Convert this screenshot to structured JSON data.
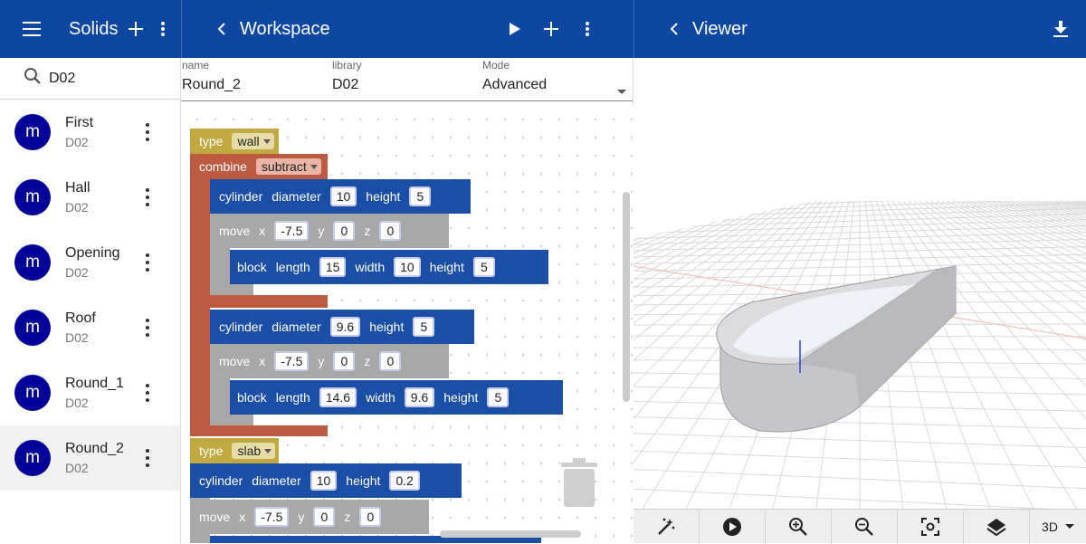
{
  "left_bar": {
    "title": "Solids"
  },
  "middle_bar": {
    "title": "Workspace"
  },
  "right_bar": {
    "title": "Viewer"
  },
  "search": {
    "value": "D02"
  },
  "solids": [
    {
      "initial": "m",
      "name": "First",
      "library": "D02"
    },
    {
      "initial": "m",
      "name": "Hall",
      "library": "D02"
    },
    {
      "initial": "m",
      "name": "Opening",
      "library": "D02"
    },
    {
      "initial": "m",
      "name": "Roof",
      "library": "D02"
    },
    {
      "initial": "m",
      "name": "Round_1",
      "library": "D02"
    },
    {
      "initial": "m",
      "name": "Round_2",
      "library": "D02",
      "selected": true
    }
  ],
  "fields": {
    "name_label": "name",
    "name_value": "Round_2",
    "library_label": "library",
    "library_value": "D02",
    "mode_label": "Mode",
    "mode_value": "Advanced"
  },
  "blocks": {
    "type1": {
      "label": "type",
      "value": "wall"
    },
    "combine": {
      "label": "combine",
      "value": "subtract"
    },
    "cyl1": {
      "label": "cylinder",
      "diameter_label": "diameter",
      "diameter": "10",
      "height_label": "height",
      "height": "5"
    },
    "move1": {
      "label": "move",
      "x_label": "x",
      "x": "-7.5",
      "y_label": "y",
      "y": "0",
      "z_label": "z",
      "z": "0"
    },
    "block1": {
      "label": "block",
      "length_label": "length",
      "length": "15",
      "width_label": "width",
      "width": "10",
      "height_label": "height",
      "height": "5"
    },
    "cyl2": {
      "label": "cylinder",
      "diameter_label": "diameter",
      "diameter": "9.6",
      "height_label": "height",
      "height": "5"
    },
    "move2": {
      "label": "move",
      "x_label": "x",
      "x": "-7.5",
      "y_label": "y",
      "y": "0",
      "z_label": "z",
      "z": "0"
    },
    "block2": {
      "label": "block",
      "length_label": "length",
      "length": "14.6",
      "width_label": "width",
      "width": "9.6",
      "height_label": "height",
      "height": "5"
    },
    "type2": {
      "label": "type",
      "value": "slab"
    },
    "cyl3": {
      "label": "cylinder",
      "diameter_label": "diameter",
      "diameter": "10",
      "height_label": "height",
      "height": "0.2"
    },
    "move3": {
      "label": "move",
      "x_label": "x",
      "x": "-7.5",
      "y_label": "y",
      "y": "0",
      "z_label": "z",
      "z": "0"
    }
  },
  "viewer_toolbar": {
    "view_mode": "3D"
  },
  "colors": {
    "appbar": "#0d47a1",
    "avatar": "#000099",
    "type_block": "#bfa940",
    "combine_block": "#bd5a42",
    "shape_block": "#1b4ea6",
    "move_block": "#a8a8a8"
  }
}
